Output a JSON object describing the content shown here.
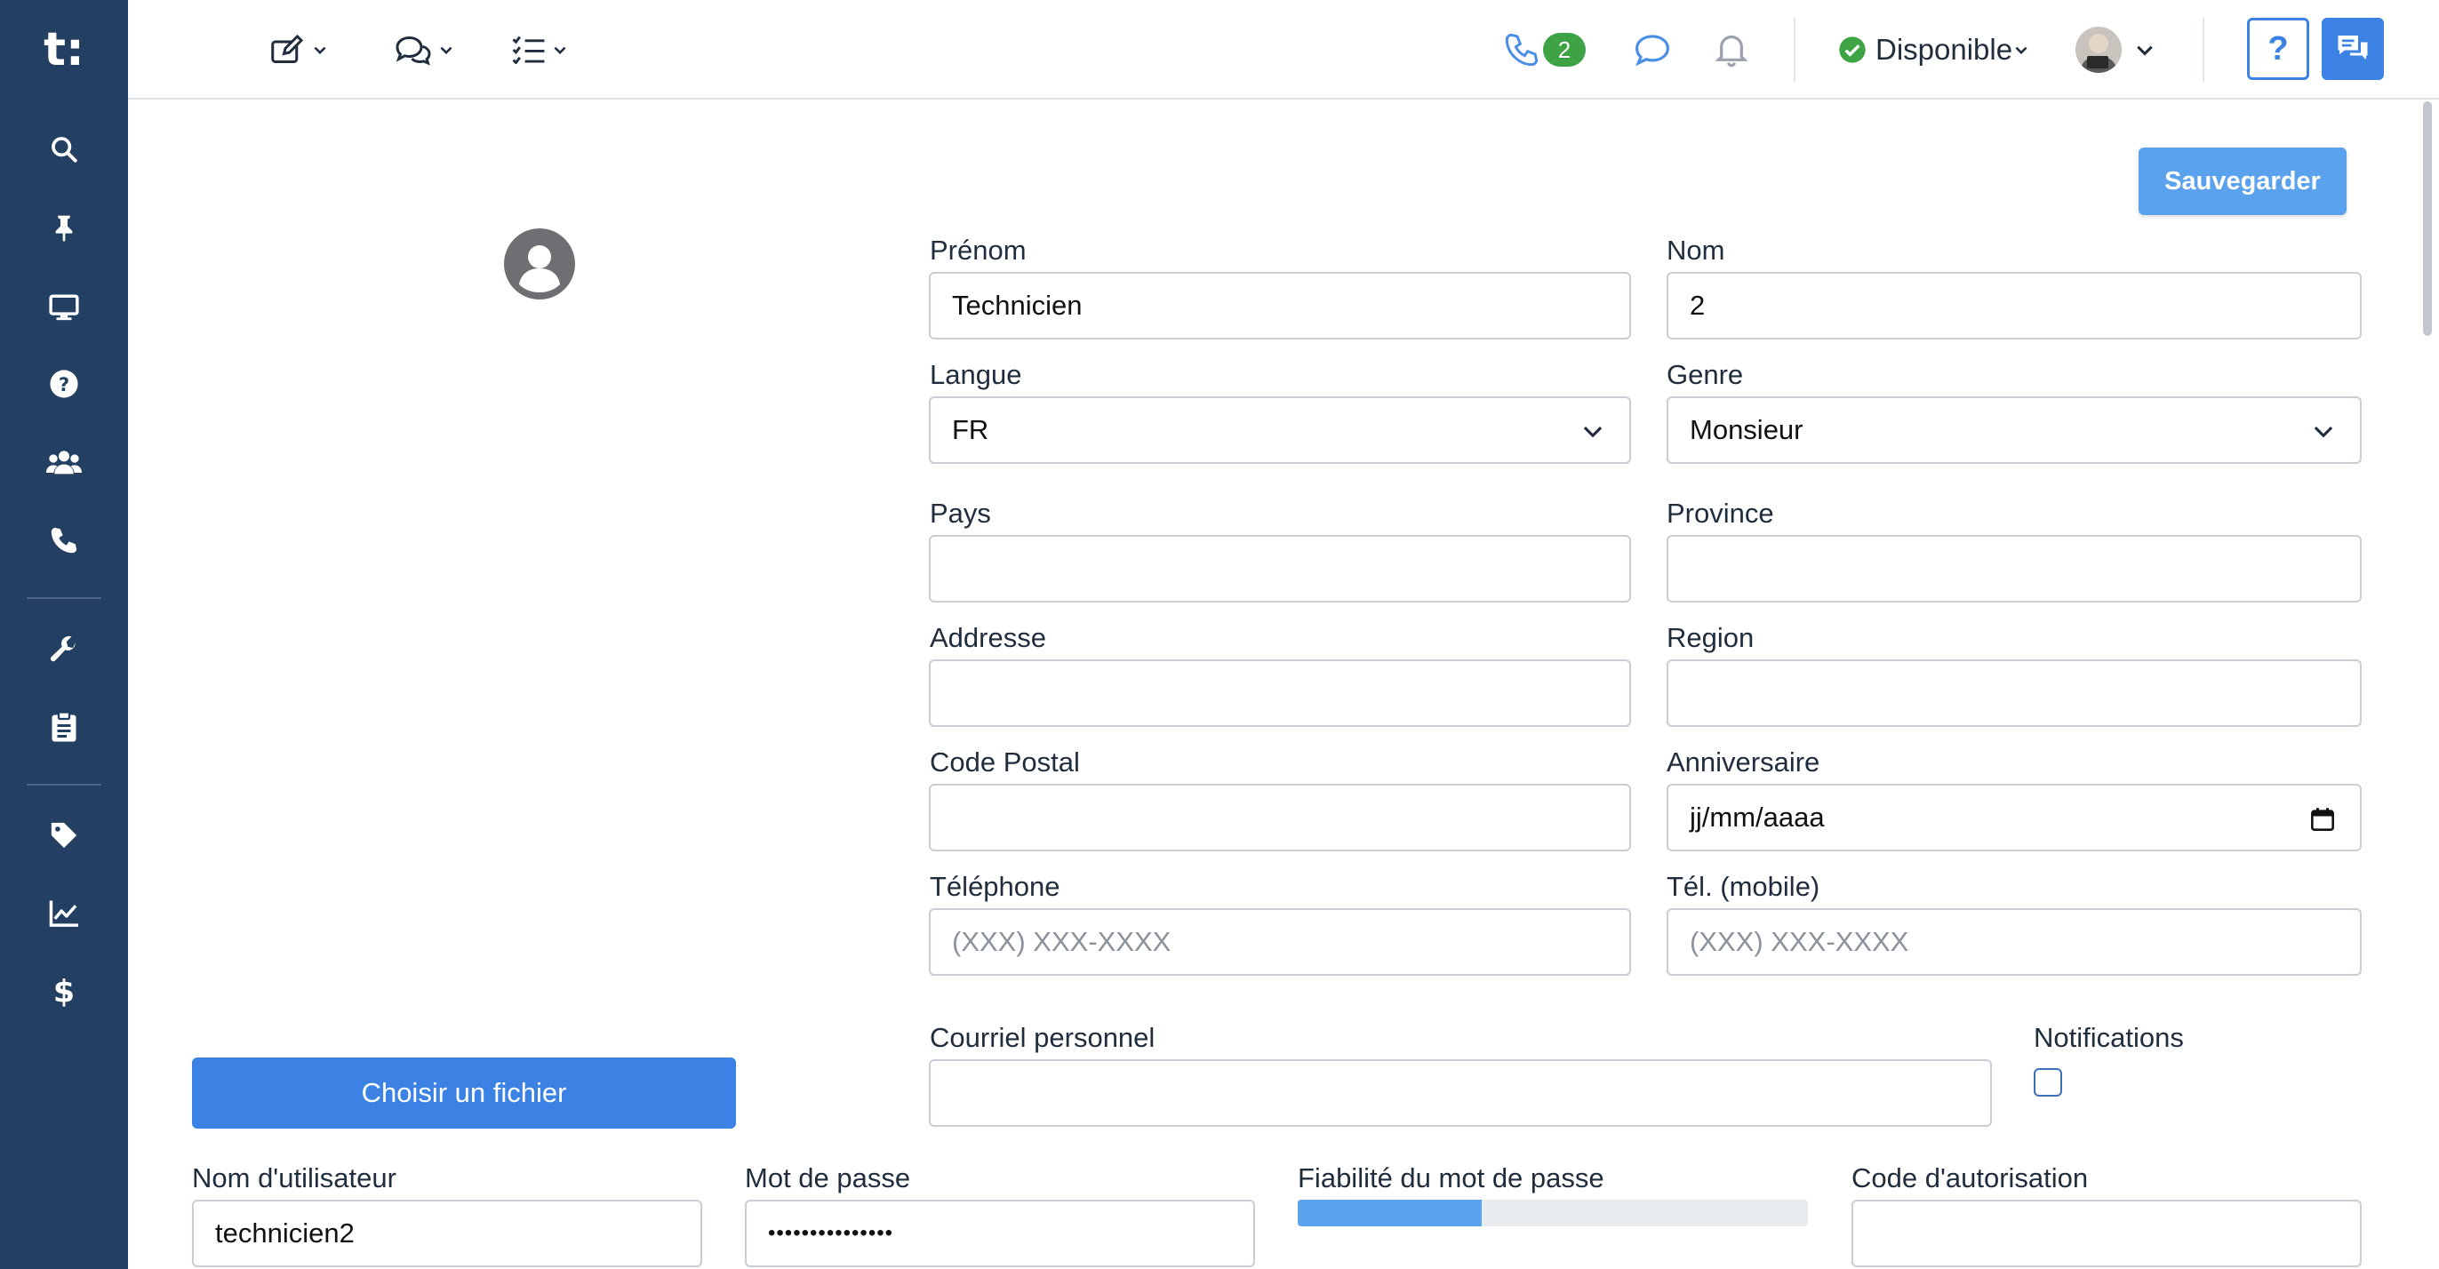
{
  "app": {
    "logo_text": "t",
    "logo_dot": ":"
  },
  "sidebar": {
    "items": [
      {
        "name": "search",
        "icon": "search-icon"
      },
      {
        "name": "pin",
        "icon": "pin-icon"
      },
      {
        "name": "monitor",
        "icon": "monitor-icon"
      },
      {
        "name": "help",
        "icon": "question-circle-icon"
      },
      {
        "name": "users",
        "icon": "users-icon"
      },
      {
        "name": "phone",
        "icon": "phone-icon"
      },
      {
        "name": "tools",
        "icon": "wrench-icon"
      },
      {
        "name": "clipboard",
        "icon": "clipboard-icon"
      },
      {
        "name": "tags",
        "icon": "tag-icon"
      },
      {
        "name": "reports",
        "icon": "chart-line-icon"
      },
      {
        "name": "billing",
        "icon": "dollar-icon"
      }
    ]
  },
  "topbar": {
    "phone_count": "2",
    "status_label": "Disponible",
    "status_color": "#3ea344",
    "help_label": "?"
  },
  "form": {
    "save_label": "Sauvegarder",
    "choose_file_label": "Choisir un fichier",
    "first_name": {
      "label": "Prénom",
      "value": "Technicien"
    },
    "last_name": {
      "label": "Nom",
      "value": "2"
    },
    "language": {
      "label": "Langue",
      "value": "FR"
    },
    "gender": {
      "label": "Genre",
      "value": "Monsieur"
    },
    "country": {
      "label": "Pays",
      "value": ""
    },
    "province": {
      "label": "Province",
      "value": ""
    },
    "address": {
      "label": "Addresse",
      "value": ""
    },
    "region": {
      "label": "Region",
      "value": ""
    },
    "postal_code": {
      "label": "Code Postal",
      "value": ""
    },
    "birthday": {
      "label": "Anniversaire",
      "placeholder": "jj/mm/aaaa"
    },
    "phone": {
      "label": "Téléphone",
      "placeholder": "(XXX) XXX-XXXX"
    },
    "mobile": {
      "label": "Tél. (mobile)",
      "placeholder": "(XXX) XXX-XXXX"
    },
    "personal_email": {
      "label": "Courriel personnel",
      "value": ""
    },
    "notifications": {
      "label": "Notifications",
      "checked": false
    },
    "username": {
      "label": "Nom d'utilisateur",
      "value": "technicien2"
    },
    "password": {
      "label": "Mot de passe",
      "value": "•••••••••••••••"
    },
    "password_strength": {
      "label": "Fiabilité du mot de passe",
      "fraction": 0.36
    },
    "auth_code": {
      "label": "Code d'autorisation",
      "value": ""
    }
  }
}
